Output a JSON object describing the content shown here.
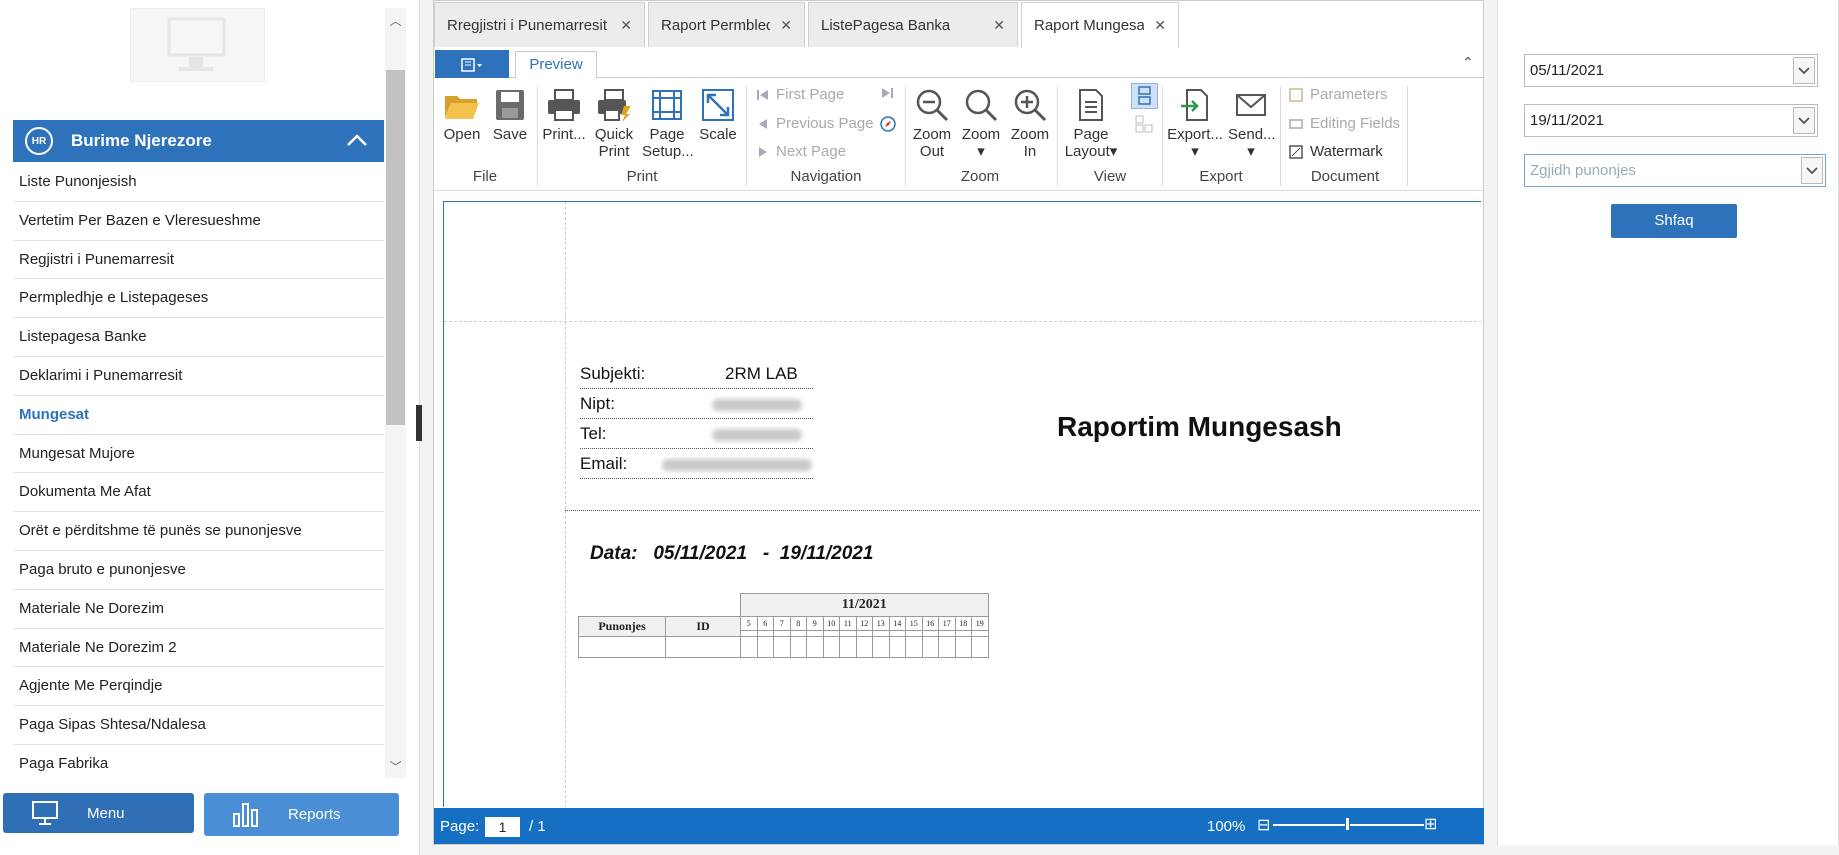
{
  "tabs": [
    {
      "label": "Rregjistri i Punemarresit"
    },
    {
      "label": "Raport Permbledhje"
    },
    {
      "label": "ListePagesa Banka"
    },
    {
      "label": "Raport Mungesat"
    }
  ],
  "sidebar": {
    "logo_badge": "HR",
    "group_title": "Burime Njerezore",
    "items": [
      "Liste Punonjesish",
      "Vertetim Per Bazen e Vleresueshme",
      "Regjistri i Punemarresit",
      "Permpledhje e Listepageses",
      "Listepagesa Banke",
      "Deklarimi i Punemarresit",
      "Mungesat",
      "Mungesat Mujore",
      "Dokumenta Me Afat",
      "Orët e përditshme të punës se punonjesve",
      "Paga bruto e punonjesve",
      "Materiale Ne Dorezim",
      "Materiale Ne Dorezim 2",
      "Agjente Me Perqindje",
      "Paga Sipas Shtesa/Ndalesa",
      "Paga Fabrika"
    ],
    "active_item": "Mungesat",
    "menu_button": "Menu",
    "reports_button": "Reports"
  },
  "ribbon": {
    "preview_tab": "Preview",
    "file": {
      "open": "Open",
      "save": "Save",
      "label": "File"
    },
    "print": {
      "print": "Print...",
      "quick_print_1": "Quick",
      "quick_print_2": "Print",
      "page_setup_1": "Page",
      "page_setup_2": "Setup...",
      "scale": "Scale",
      "label": "Print"
    },
    "navigation": {
      "first": "First Page",
      "previous": "Previous Page",
      "next": "Next Page",
      "label": "Navigation"
    },
    "zoom": {
      "out_1": "Zoom",
      "out_2": "Out",
      "zoom": "Zoom",
      "in_1": "Zoom",
      "in_2": "In",
      "label": "Zoom"
    },
    "view": {
      "layout_1": "Page",
      "layout_2": "Layout",
      "label": "View"
    },
    "export": {
      "export": "Export...",
      "send": "Send...",
      "label": "Export"
    },
    "document": {
      "parameters": "Parameters",
      "editing": "Editing Fields",
      "watermark": "Watermark",
      "label": "Document"
    }
  },
  "report": {
    "subjekti_label": "Subjekti:",
    "subjekti_value": "2RM LAB",
    "nipt_label": "Nipt:",
    "tel_label": "Tel:",
    "email_label": "Email:",
    "title": "Raportim Mungesash",
    "data_line": "Data:   05/11/2021   -  19/11/2021",
    "table": {
      "month": "11/2021",
      "col_employee": "Punonjes",
      "col_id": "ID",
      "days": [
        "5",
        "6",
        "7",
        "8",
        "9",
        "10",
        "11",
        "12",
        "13",
        "14",
        "15",
        "16",
        "17",
        "18",
        "19"
      ]
    }
  },
  "statusbar": {
    "page_label": "Page:",
    "page_value": "1",
    "page_total": "/ 1",
    "zoom": "100%"
  },
  "filters": {
    "date_from": "05/11/2021",
    "date_to": "19/11/2021",
    "employee_placeholder": "Zgjidh punonjes",
    "show_button": "Shfaq"
  }
}
